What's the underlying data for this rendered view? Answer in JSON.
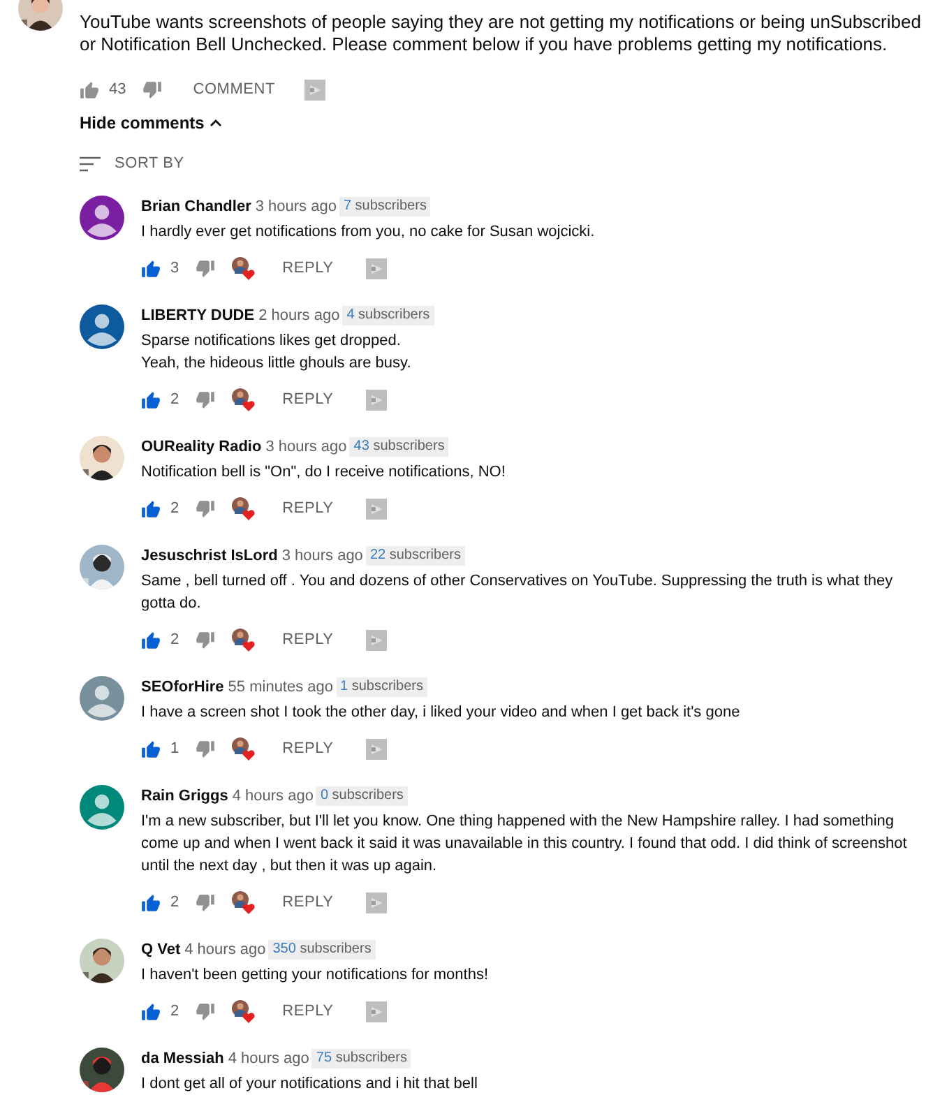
{
  "top_comment": {
    "text": "YouTube wants screenshots of people saying they are not getting my notifications or being unSubscribed or Notification Bell Unchecked. Please comment below if you have problems getting my notifications.",
    "liked": false,
    "likes": "43",
    "action": "COMMENT"
  },
  "toggle": {
    "label": "Hide comments",
    "expanded": true
  },
  "sort": {
    "label": "SORT BY"
  },
  "replies": [
    {
      "author": "Brian Chandler",
      "time": "3 hours ago",
      "subscriber_count": "7",
      "subscriber_label": "subscribers",
      "avatar": {
        "kind": "default",
        "color": "#7b1fa2"
      },
      "text": "I hardly ever get notifications from you, no cake for Susan wojcicki.",
      "liked": true,
      "likes": "3",
      "hearted": true,
      "action": "REPLY"
    },
    {
      "author": "LIBERTY DUDE",
      "time": "2 hours ago",
      "subscriber_count": "4",
      "subscriber_label": "subscribers",
      "avatar": {
        "kind": "default",
        "color": "#0d5a9e"
      },
      "text": "Sparse notifications likes get dropped.\nYeah, the hideous little ghouls are busy.",
      "liked": true,
      "likes": "2",
      "hearted": true,
      "action": "REPLY"
    },
    {
      "author": "OUReality Radio",
      "time": "3 hours ago",
      "subscriber_count": "43",
      "subscriber_label": "subscribers",
      "text": "Notification bell is \"On\", do I receive notifications, NO!",
      "liked": true,
      "likes": "2",
      "hearted": true,
      "action": "REPLY"
    },
    {
      "author": "Jesuschrist IsLord",
      "time": "3 hours ago",
      "subscriber_count": "22",
      "subscriber_label": "subscribers",
      "text": "Same , bell turned off . You and dozens of other Conservatives on YouTube. Suppressing the truth is what they gotta do.",
      "liked": true,
      "likes": "2",
      "hearted": true,
      "action": "REPLY"
    },
    {
      "author": "SEOforHire",
      "time": "55 minutes ago",
      "subscriber_count": "1",
      "subscriber_label": "subscribers",
      "avatar": {
        "kind": "default",
        "color": "#78909c"
      },
      "text": "I have a screen shot I took the other day, i liked your video and when I get back it's gone",
      "liked": true,
      "likes": "1",
      "hearted": true,
      "action": "REPLY"
    },
    {
      "author": "Rain Griggs",
      "time": "4 hours ago",
      "subscriber_count": "0",
      "subscriber_label": "subscribers",
      "avatar": {
        "kind": "default",
        "color": "#00897b"
      },
      "text": "I'm a new subscriber, but I'll let you know. One thing happened with the New Hampshire ralley.  I had something come up and when I went back it said it was unavailable in this country. I found that odd. I did think of screenshot until the next day , but then it was up again.",
      "liked": true,
      "likes": "2",
      "hearted": true,
      "action": "REPLY"
    },
    {
      "author": "Q Vet",
      "time": "4 hours ago",
      "subscriber_count": "350",
      "subscriber_label": "subscribers",
      "text": "I haven't been getting your notifications for months!",
      "liked": true,
      "likes": "2",
      "hearted": true,
      "action": "REPLY"
    },
    {
      "author": "da Messiah",
      "time": "4 hours ago",
      "subscriber_count": "75",
      "subscriber_label": "subscribers",
      "text": "I dont get all of your notifications and i hit that bell"
    }
  ]
}
